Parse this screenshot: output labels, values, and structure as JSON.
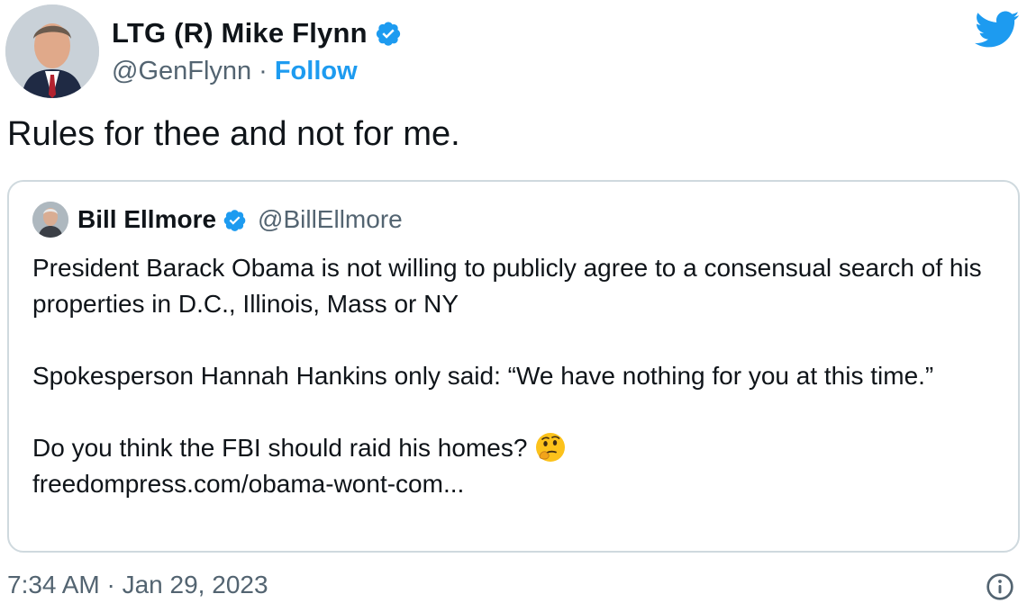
{
  "author": {
    "display_name": "LTG (R) Mike Flynn",
    "handle": "@GenFlynn",
    "separator": "·",
    "follow_label": "Follow",
    "verified_icon": "verified-badge-icon",
    "avatar_icon": "profile-photo"
  },
  "brand": {
    "logo_icon": "twitter-bird-icon",
    "accent_color": "#1d9bf0"
  },
  "tweet": {
    "text": "Rules for thee and not for me."
  },
  "quoted_tweet": {
    "display_name": "Bill Ellmore",
    "handle": "@BillEllmore",
    "paragraph_1": "President Barack Obama is not willing to publicly agree to a consensual search of his properties in D.C., Illinois, Mass or NY",
    "paragraph_2": "Spokesperson Hannah Hankins only said: “We have nothing for you at this time.”",
    "paragraph_3": "Do you think the FBI should raid his homes?",
    "emoji": "thinking-face-emoji",
    "link": "freedompress.com/obama-wont-com..."
  },
  "footer": {
    "timestamp": "7:34 AM · Jan 29, 2023",
    "info_icon": "info-icon"
  }
}
